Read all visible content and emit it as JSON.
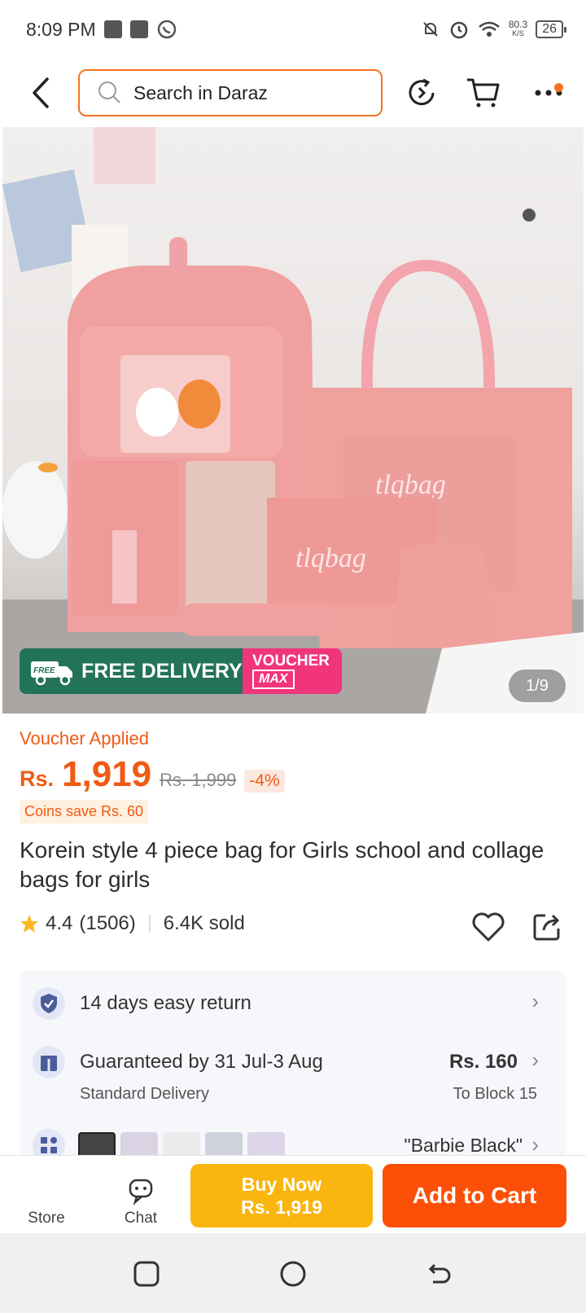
{
  "status_bar": {
    "time": "8:09 PM",
    "net_speed_value": "80.3",
    "net_speed_unit": "K/S",
    "battery": "26"
  },
  "search": {
    "placeholder": "Search in Daraz"
  },
  "product": {
    "image_counter": "1/9",
    "image_text": "tlqbag",
    "delivery_badge": "FREE DELIVERY",
    "delivery_badge_tag": "FREE",
    "voucher_badge_line1": "VOUCHER",
    "voucher_badge_line2": "MAX",
    "voucher_applied": "Voucher Applied",
    "currency": "Rs.",
    "price": "1,919",
    "original_price": "Rs. 1,999",
    "discount": "-4%",
    "coins_save": "Coins save Rs. 60",
    "title": "Korein style 4 piece bag for Girls school and collage bags for girls",
    "rating": "4.4",
    "rating_count": "(1506)",
    "sold": "6.4K sold"
  },
  "info": {
    "return_text": "14 days easy return",
    "guarantee_text": "Guaranteed by 31 Jul-3 Aug",
    "delivery_type": "Standard Delivery",
    "delivery_price": "Rs. 160",
    "delivery_location": "To Block 15",
    "variant_name": "\"Barbie Black\""
  },
  "actions": {
    "store_label": "Store",
    "chat_label": "Chat",
    "buy_now_line1": "Buy Now",
    "buy_now_line2": "Rs. 1,919",
    "add_to_cart": "Add to Cart"
  },
  "colors": {
    "brand_orange": "#f57224",
    "price_orange": "#f05a14",
    "buy_now_yellow": "#fbb50f",
    "add_cart_orange": "#fc5008",
    "delivery_green": "#23725a",
    "voucher_pink": "#f0357a"
  },
  "icons": [
    "back-arrow-icon",
    "search-icon",
    "refresh-icon",
    "cart-icon",
    "more-icon",
    "star-icon",
    "heart-icon",
    "share-icon",
    "shield-check-icon",
    "gift-icon",
    "grid-icon",
    "chevron-right-icon",
    "store-icon",
    "chat-icon",
    "square-icon",
    "circle-icon",
    "back-nav-icon"
  ]
}
